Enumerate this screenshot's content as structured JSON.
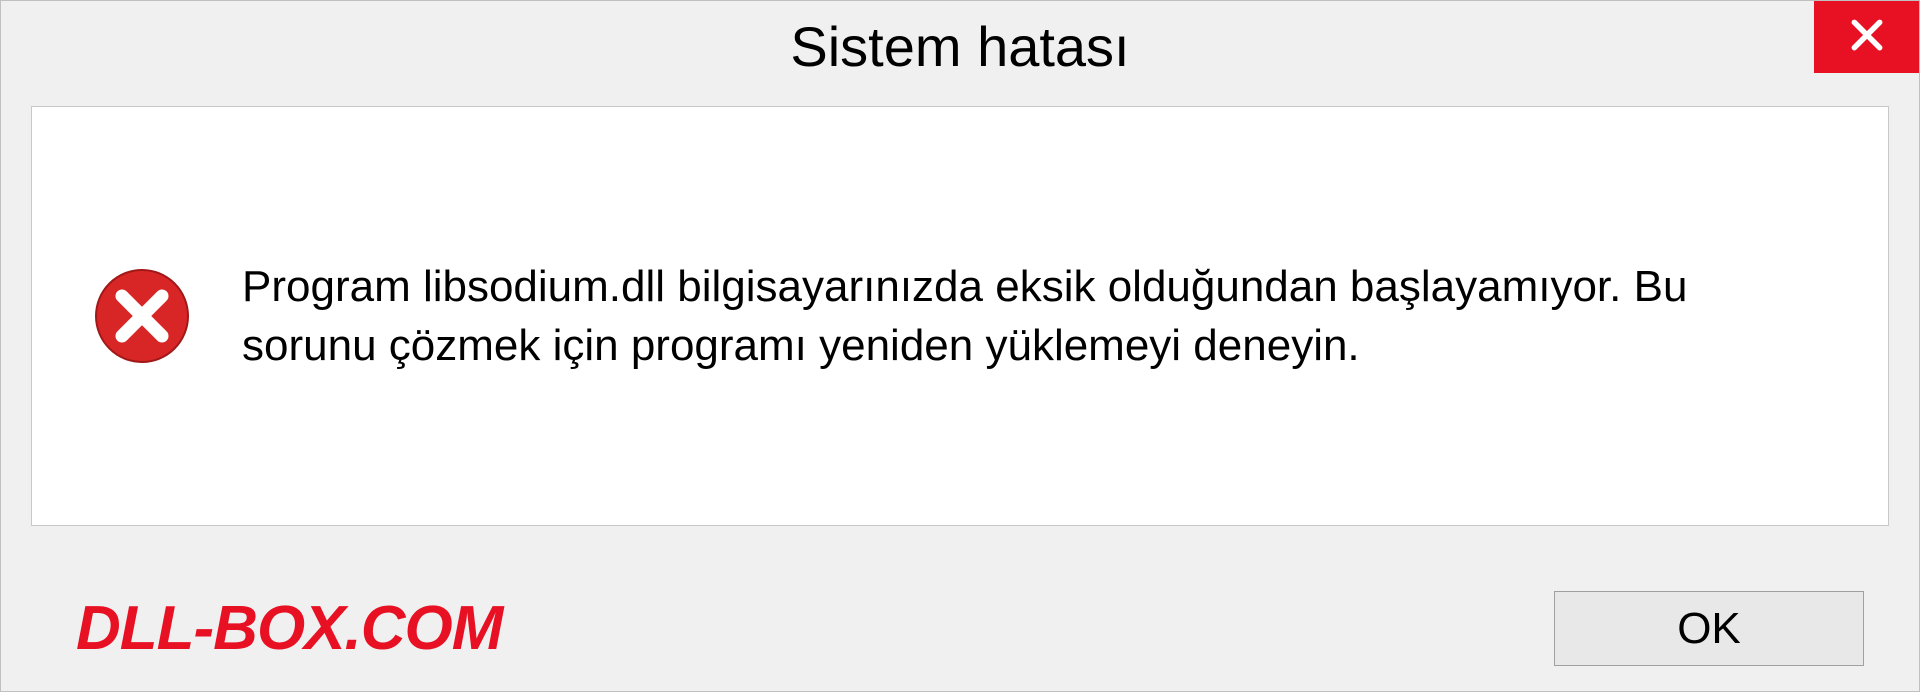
{
  "titlebar": {
    "title": "Sistem hatası"
  },
  "content": {
    "message": "Program libsodium.dll bilgisayarınızda eksik olduğundan başlayamıyor. Bu sorunu çözmek için programı yeniden yüklemeyi deneyin."
  },
  "footer": {
    "watermark": "DLL-BOX.COM",
    "ok_label": "OK"
  },
  "colors": {
    "close_bg": "#e81123",
    "watermark": "#e81123",
    "error_icon": "#d82626"
  }
}
